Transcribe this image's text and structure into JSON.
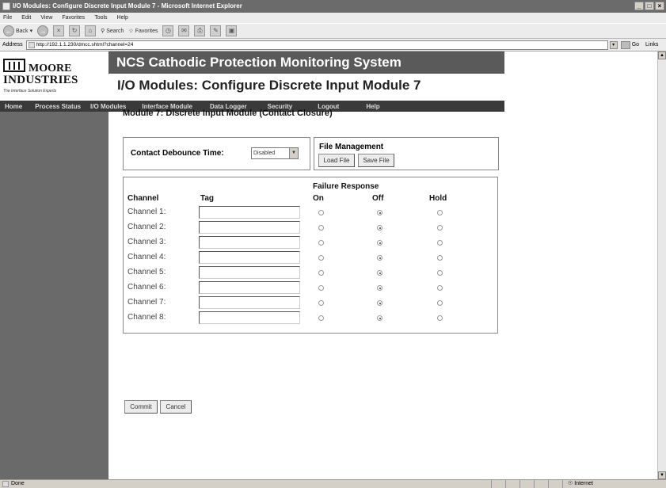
{
  "window": {
    "title": "I/O Modules: Configure Discrete Input Module 7 - Microsoft Internet Explorer",
    "controls": [
      "_",
      "□",
      "×"
    ]
  },
  "menu": [
    "File",
    "Edit",
    "View",
    "Favorites",
    "Tools",
    "Help"
  ],
  "toolbar": {
    "back": "Back",
    "search": "Search",
    "favorites": "Favorites"
  },
  "address": {
    "label": "Address",
    "url": "http://192.1.1.230/dmcc.shtml?channel=24",
    "go": "Go",
    "links": "Links"
  },
  "logo": {
    "name": "MOORE",
    "name2": "INDUSTRIES",
    "tagline": "The Interface Solution Experts"
  },
  "banner": "NCS Cathodic Protection Monitoring System",
  "page_title": "I/O Modules: Configure Discrete Input Module 7",
  "nav": [
    "Home",
    "Process Status",
    "I/O Modules",
    "Interface Module",
    "Data Logger",
    "Security",
    "Logout",
    "Help"
  ],
  "module_title": "Module 7: Discrete Input Module (Contact Closure)",
  "debounce": {
    "label": "Contact Debounce Time:",
    "value": "Disabled"
  },
  "file_management": {
    "label": "File Management",
    "load": "Load File",
    "save": "Save File"
  },
  "table": {
    "failure_response": "Failure Response",
    "headers": [
      "Channel",
      "Tag",
      "On",
      "Off",
      "Hold"
    ],
    "rows": [
      {
        "label": "Channel 1:",
        "tag": "",
        "selected": "Off"
      },
      {
        "label": "Channel 2:",
        "tag": "",
        "selected": "Off"
      },
      {
        "label": "Channel 3:",
        "tag": "",
        "selected": "Off"
      },
      {
        "label": "Channel 4:",
        "tag": "",
        "selected": "Off"
      },
      {
        "label": "Channel 5:",
        "tag": "",
        "selected": "Off"
      },
      {
        "label": "Channel 6:",
        "tag": "",
        "selected": "Off"
      },
      {
        "label": "Channel 7:",
        "tag": "",
        "selected": "Off"
      },
      {
        "label": "Channel 8:",
        "tag": "",
        "selected": "Off"
      }
    ]
  },
  "actions": {
    "commit": "Commit",
    "cancel": "Cancel"
  },
  "status": {
    "text": "Done",
    "zone": "Internet"
  }
}
